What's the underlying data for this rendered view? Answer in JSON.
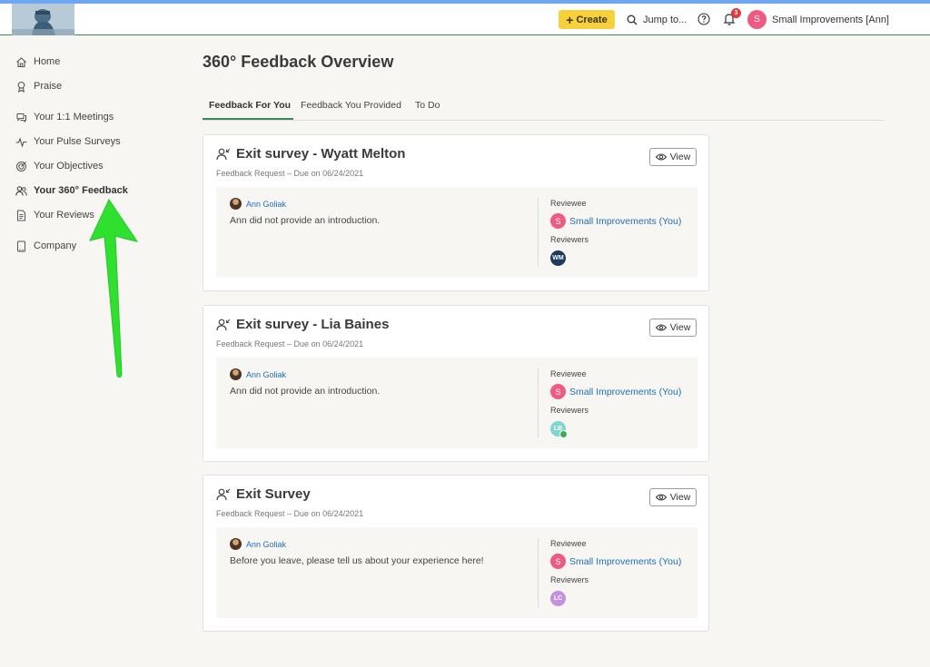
{
  "topbar": {
    "create_label": "Create",
    "jump_label": "Jump to...",
    "notification_count": "3",
    "user_initial": "S",
    "user_name": "Small Improvements [Ann]"
  },
  "sidebar": {
    "items": [
      {
        "label": "Home",
        "icon": "home-icon"
      },
      {
        "label": "Praise",
        "icon": "award-icon"
      },
      {
        "label": "Your 1:1 Meetings",
        "icon": "chat-icon"
      },
      {
        "label": "Your Pulse Surveys",
        "icon": "pulse-icon"
      },
      {
        "label": "Your Objectives",
        "icon": "target-icon"
      },
      {
        "label": "Your 360° Feedback",
        "icon": "people-icon",
        "active": true
      },
      {
        "label": "Your Reviews",
        "icon": "document-icon"
      },
      {
        "label": "Company",
        "icon": "building-icon"
      }
    ]
  },
  "main": {
    "title": "360° Feedback Overview",
    "tabs": [
      "Feedback For You",
      "Feedback You Provided",
      "To Do"
    ]
  },
  "cards": [
    {
      "title": "Exit survey - Wyatt Melton",
      "subtitle": "Feedback Request – Due on 06/24/2021",
      "view_label": "View",
      "author": "Ann Goliak",
      "intro": "Ann did not provide an introduction.",
      "reviewee_label": "Reviewee",
      "reviewee_initial": "S",
      "reviewee": "Small Improvements (You)",
      "reviewers_label": "Reviewers",
      "reviewer_initials": "WM",
      "reviewer_color": "#1e3a5f"
    },
    {
      "title": "Exit survey - Lia Baines",
      "subtitle": "Feedback Request – Due on 06/24/2021",
      "view_label": "View",
      "author": "Ann Goliak",
      "intro": "Ann did not provide an introduction.",
      "reviewee_label": "Reviewee",
      "reviewee_initial": "S",
      "reviewee": "Small Improvements (You)",
      "reviewers_label": "Reviewers",
      "reviewer_initials": "LB",
      "reviewer_color": "#7fd6cf"
    },
    {
      "title": "Exit Survey",
      "subtitle": "Feedback Request – Due on 06/24/2021",
      "view_label": "View",
      "author": "Ann Goliak",
      "intro": "Before you leave, please tell us about your experience here!",
      "reviewee_label": "Reviewee",
      "reviewee_initial": "S",
      "reviewee": "Small Improvements (You)",
      "reviewers_label": "Reviewers",
      "reviewer_initials": "LC",
      "reviewer_color": "#c191e0"
    }
  ],
  "colors": {
    "accent_green": "#3f8a4f",
    "create_yellow": "#f7d13b",
    "link_blue": "#1f6fb8",
    "annotation_arrow": "#2fe02f"
  }
}
